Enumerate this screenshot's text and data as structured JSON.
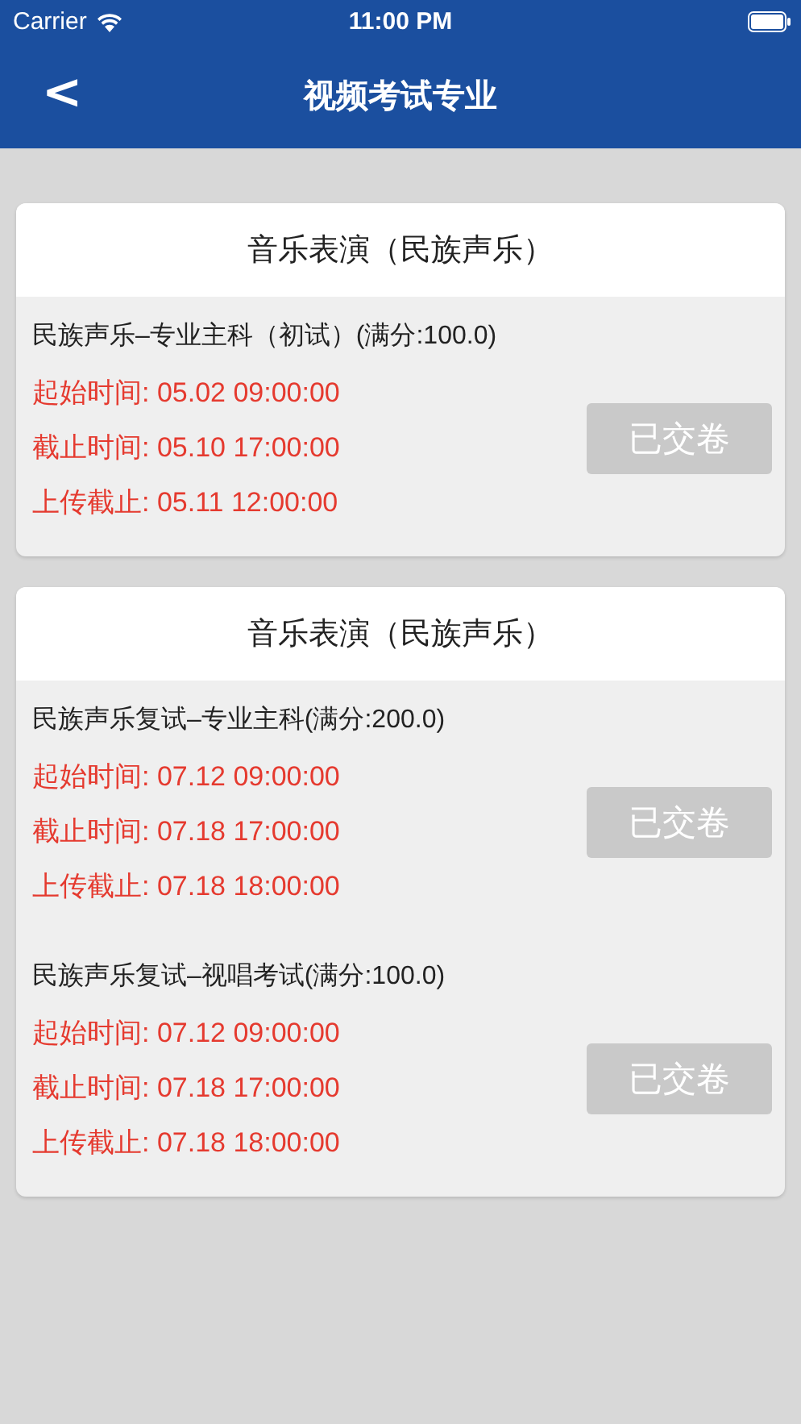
{
  "status_bar": {
    "carrier": "Carrier",
    "time": "11:00 PM"
  },
  "nav": {
    "back": "<",
    "title": "视频考试专业"
  },
  "sections": [
    {
      "title": "音乐表演（民族声乐）",
      "exams": [
        {
          "name": "民族声乐–专业主科（初试）(满分:100.0)",
          "lines": [
            "起始时间: 05.02 09:00:00",
            "截止时间: 05.10 17:00:00",
            "上传截止: 05.11 12:00:00"
          ],
          "button": "已交卷",
          "disabled": true
        }
      ]
    },
    {
      "title": "音乐表演（民族声乐）",
      "exams": [
        {
          "name": "民族声乐复试–专业主科(满分:200.0)",
          "lines": [
            "起始时间: 07.12 09:00:00",
            "截止时间: 07.18 17:00:00",
            "上传截止: 07.18 18:00:00"
          ],
          "button": "已交卷",
          "disabled": true
        },
        {
          "name": "民族声乐复试–视唱考试(满分:100.0)",
          "lines": [
            "起始时间: 07.12 09:00:00",
            "截止时间: 07.18 17:00:00",
            "上传截止: 07.18 18:00:00"
          ],
          "button": "已交卷",
          "disabled": true
        }
      ]
    }
  ]
}
